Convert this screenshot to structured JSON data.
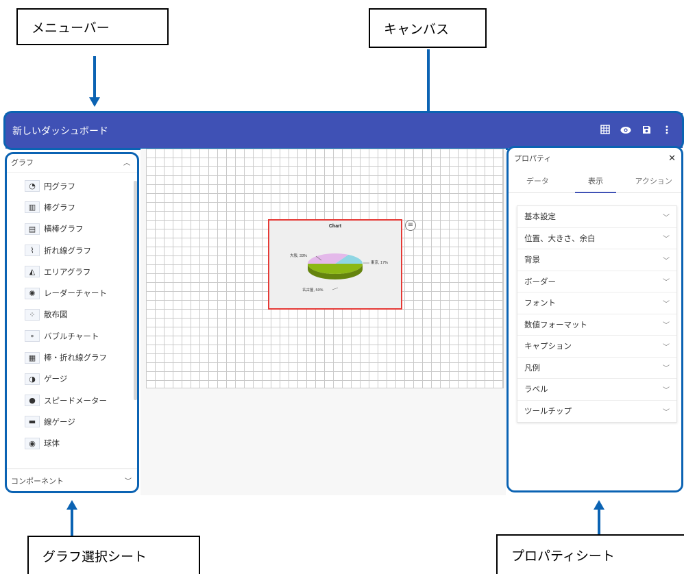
{
  "annotations": {
    "menubar": "メニューバー",
    "canvas": "キャンバス",
    "graph_sheet": "グラフ選択シート",
    "property_sheet": "プロパティシート"
  },
  "app": {
    "title": "新しいダッシュボード",
    "toolbar_icons": [
      "grid-icon",
      "eye-icon",
      "save-icon",
      "more-vert-icon"
    ]
  },
  "left_panel": {
    "header": "グラフ",
    "items": [
      {
        "label": "円グラフ",
        "icon": "pie-chart-icon"
      },
      {
        "label": "棒グラフ",
        "icon": "bar-chart-icon"
      },
      {
        "label": "横棒グラフ",
        "icon": "horizontal-bar-chart-icon"
      },
      {
        "label": "折れ線グラフ",
        "icon": "line-chart-icon"
      },
      {
        "label": "エリアグラフ",
        "icon": "area-chart-icon"
      },
      {
        "label": "レーダーチャート",
        "icon": "radar-chart-icon"
      },
      {
        "label": "散布図",
        "icon": "scatter-chart-icon"
      },
      {
        "label": "バブルチャート",
        "icon": "bubble-chart-icon"
      },
      {
        "label": "棒・折れ線グラフ",
        "icon": "bar-line-chart-icon"
      },
      {
        "label": "ゲージ",
        "icon": "gauge-icon"
      },
      {
        "label": "スピードメーター",
        "icon": "speedometer-icon"
      },
      {
        "label": "線ゲージ",
        "icon": "linear-gauge-icon"
      },
      {
        "label": "球体",
        "icon": "sphere-icon"
      }
    ],
    "footer": "コンポーネント"
  },
  "chart_data": {
    "type": "pie",
    "title": "Chart",
    "categories": [
      "東京",
      "名古屋",
      "大阪"
    ],
    "values": [
      17,
      50,
      33
    ],
    "labels": [
      "東京, 17%",
      "名古屋, 50%",
      "大阪, 33%"
    ],
    "colors": [
      "#8fd6e3",
      "#8cb814",
      "#e4b9ea"
    ]
  },
  "right_panel": {
    "title": "プロパティ",
    "close": "✕",
    "tabs": [
      "データ",
      "表示",
      "アクション"
    ],
    "active_tab": "表示",
    "sections": [
      "基本設定",
      "位置、大きさ、余白",
      "背景",
      "ボーダー",
      "フォント",
      "数値フォーマット",
      "キャプション",
      "凡例",
      "ラベル",
      "ツールチップ"
    ]
  },
  "colors": {
    "app_bar": "#3f51b5",
    "annotation_blue": "#0b63b3",
    "selection_red": "#e53935"
  }
}
